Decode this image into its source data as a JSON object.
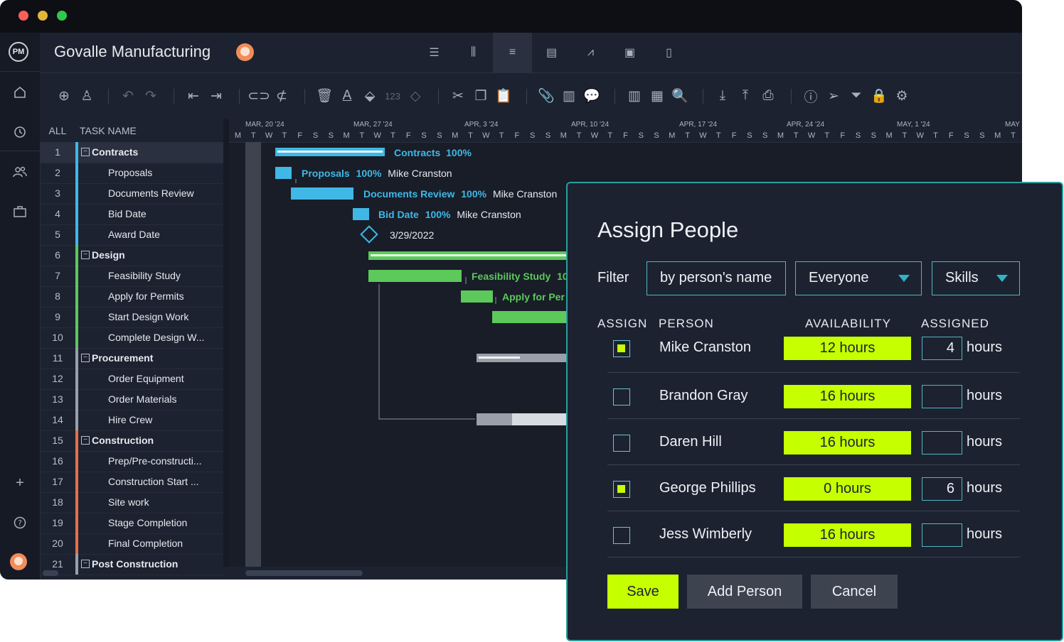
{
  "app": {
    "logo": "PM",
    "title": "Govalle Manufacturing",
    "avatar_icon": "user-avatar",
    "views": [
      "list-view-icon",
      "board-view-icon",
      "gantt-view-icon",
      "sheet-view-icon",
      "dashboard-view-icon",
      "calendar-view-icon",
      "files-view-icon"
    ],
    "active_view": 2
  },
  "sidebar": {
    "icons": [
      "home-icon",
      "clock-icon",
      "people-icon",
      "briefcase-icon"
    ],
    "bottom_icons": [
      "plus-icon",
      "help-icon",
      "avatar"
    ]
  },
  "toolbar": {
    "number_label": "123",
    "text_label": "A"
  },
  "grid": {
    "col_all": "ALL",
    "col_task": "TASK NAME",
    "rows": [
      {
        "n": "1",
        "name": "Contracts",
        "group": true,
        "color": "#3fb8e6"
      },
      {
        "n": "2",
        "name": "Proposals",
        "group": false,
        "color": "#3fb8e6"
      },
      {
        "n": "3",
        "name": "Documents Review",
        "group": false,
        "color": "#3fb8e6"
      },
      {
        "n": "4",
        "name": "Bid Date",
        "group": false,
        "color": "#3fb8e6"
      },
      {
        "n": "5",
        "name": "Award Date",
        "group": false,
        "color": "#3fb8e6"
      },
      {
        "n": "6",
        "name": "Design",
        "group": true,
        "color": "#5cc95a"
      },
      {
        "n": "7",
        "name": "Feasibility Study",
        "group": false,
        "color": "#5cc95a"
      },
      {
        "n": "8",
        "name": "Apply for Permits",
        "group": false,
        "color": "#5cc95a"
      },
      {
        "n": "9",
        "name": "Start Design Work",
        "group": false,
        "color": "#5cc95a"
      },
      {
        "n": "10",
        "name": "Complete Design W...",
        "group": false,
        "color": "#5cc95a"
      },
      {
        "n": "11",
        "name": "Procurement",
        "group": true,
        "color": "#9aa0aa"
      },
      {
        "n": "12",
        "name": "Order Equipment",
        "group": false,
        "color": "#9aa0aa"
      },
      {
        "n": "13",
        "name": "Order Materials",
        "group": false,
        "color": "#9aa0aa"
      },
      {
        "n": "14",
        "name": "Hire Crew",
        "group": false,
        "color": "#9aa0aa"
      },
      {
        "n": "15",
        "name": "Construction",
        "group": true,
        "color": "#e86e4a"
      },
      {
        "n": "16",
        "name": "Prep/Pre-constructi...",
        "group": false,
        "color": "#e86e4a"
      },
      {
        "n": "17",
        "name": "Construction Start ...",
        "group": false,
        "color": "#e86e4a"
      },
      {
        "n": "18",
        "name": "Site work",
        "group": false,
        "color": "#e86e4a"
      },
      {
        "n": "19",
        "name": "Stage Completion",
        "group": false,
        "color": "#e86e4a"
      },
      {
        "n": "20",
        "name": "Final Completion",
        "group": false,
        "color": "#e86e4a"
      },
      {
        "n": "21",
        "name": "Post Construction",
        "group": true,
        "color": "#9aa0aa"
      }
    ]
  },
  "gantt": {
    "weeks": [
      "MAR, 20 '24",
      "MAR, 27 '24",
      "APR, 3 '24",
      "APR, 10 '24",
      "APR, 17 '24",
      "APR, 24 '24",
      "MAY, 1 '24",
      "MAY"
    ],
    "days": [
      "M",
      "T",
      "W",
      "T",
      "F",
      "S",
      "S",
      "M",
      "T",
      "W",
      "T",
      "F",
      "S",
      "S",
      "M",
      "T",
      "W",
      "T",
      "F",
      "S",
      "S",
      "M",
      "T",
      "W",
      "T",
      "F",
      "S",
      "S",
      "M",
      "T",
      "W",
      "T",
      "F",
      "S",
      "S",
      "M",
      "T",
      "W",
      "T",
      "F",
      "S",
      "S",
      "M",
      "T",
      "W",
      "T",
      "F",
      "S",
      "S",
      "M",
      "T"
    ],
    "bars": [
      {
        "label": "Contracts",
        "pct": "100%",
        "person": ""
      },
      {
        "label": "Proposals",
        "pct": "100%",
        "person": "Mike Cranston"
      },
      {
        "label": "Documents Review",
        "pct": "100%",
        "person": "Mike Cranston"
      },
      {
        "label": "Bid Date",
        "pct": "100%",
        "person": "Mike Cranston"
      },
      {
        "label": "",
        "pct": "",
        "person": "3/29/2022"
      },
      {
        "label": "Feasibility Study",
        "pct": "10",
        "person": ""
      },
      {
        "label": "Apply for Per",
        "pct": "",
        "person": ""
      }
    ],
    "colors": {
      "blue": "#3fb8e6",
      "green": "#5cc95a",
      "gray": "#9aa0aa"
    }
  },
  "modal": {
    "title": "Assign People",
    "filter_label": "Filter",
    "filter_placeholder": "by person's name",
    "dropdown_everyone": "Everyone",
    "dropdown_skills": "Skills",
    "col_assign": "ASSIGN",
    "col_person": "PERSON",
    "col_availability": "AVAILABILITY",
    "col_assigned": "ASSIGNED",
    "hours_unit": "hours",
    "people": [
      {
        "name": "Mike Cranston",
        "checked": true,
        "availability": "12 hours",
        "assigned": "4"
      },
      {
        "name": "Brandon Gray",
        "checked": false,
        "availability": "16 hours",
        "assigned": ""
      },
      {
        "name": "Daren Hill",
        "checked": false,
        "availability": "16 hours",
        "assigned": ""
      },
      {
        "name": "George Phillips",
        "checked": true,
        "availability": "0 hours",
        "assigned": "6"
      },
      {
        "name": "Jess Wimberly",
        "checked": false,
        "availability": "16 hours",
        "assigned": ""
      }
    ],
    "save_label": "Save",
    "add_person_label": "Add Person",
    "cancel_label": "Cancel",
    "accent": "#c6ff00"
  }
}
